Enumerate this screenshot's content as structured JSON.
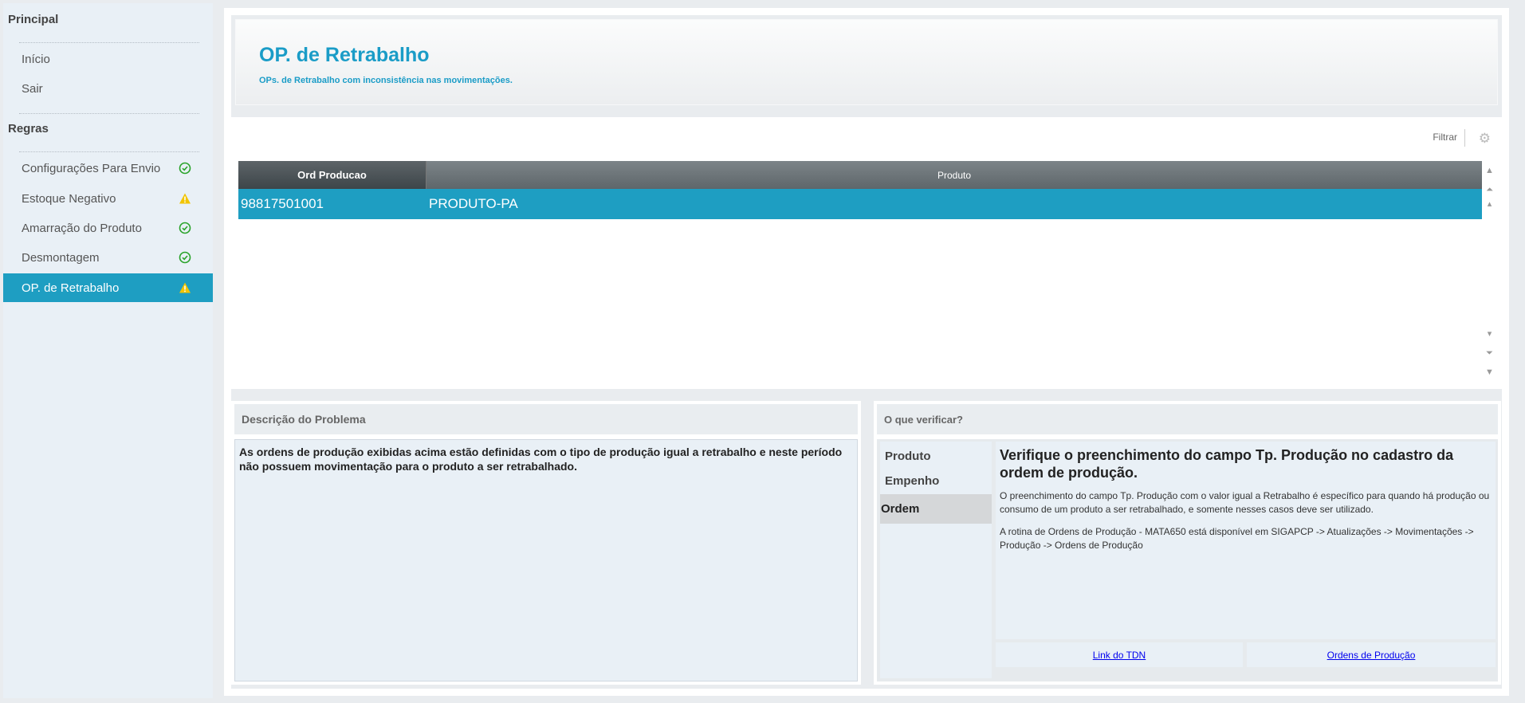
{
  "sidebar": {
    "section_principal": "Principal",
    "section_regras": "Regras",
    "nav": [
      {
        "label": "Início"
      },
      {
        "label": "Sair"
      }
    ],
    "rules": [
      {
        "label": "Configurações Para Envio",
        "status": "ok"
      },
      {
        "label": "Estoque Negativo",
        "status": "warning"
      },
      {
        "label": "Amarração do Produto",
        "status": "ok"
      },
      {
        "label": "Desmontagem",
        "status": "ok"
      },
      {
        "label": "OP. de Retrabalho",
        "status": "warning",
        "active": true
      }
    ]
  },
  "header": {
    "title": "OP. de Retrabalho",
    "subtitle": "OPs. de Retrabalho com inconsistência nas movimentações."
  },
  "grid": {
    "filter_label": "Filtrar",
    "columns": [
      "Ord Producao",
      "Produto"
    ],
    "rows": [
      {
        "ord_producao": "98817501001",
        "produto": "PRODUTO-PA"
      }
    ]
  },
  "description": {
    "title": "Descrição do Problema",
    "text": "As ordens de produção exibidas acima estão definidas com o tipo de produção igual a retrabalho e neste período não possuem movimentação para o produto a ser retrabalhado."
  },
  "check": {
    "title": "O que verificar?",
    "tabs": [
      {
        "label": "Produto"
      },
      {
        "label": "Empenho"
      },
      {
        "label": "Ordem",
        "active": true
      }
    ],
    "heading": "Verifique o preenchimento do campo Tp. Produção no cadastro da ordem de produção.",
    "paragraph1": "O preenchimento do campo Tp. Produção com o valor igual a Retrabalho é específico para quando há produção ou consumo de um produto a ser retrabalhado, e somente nesses casos deve ser utilizado.",
    "paragraph2": "A rotina de Ordens de Produção - MATA650 está disponível em SIGAPCP -> Atualizações -> Movimentações -> Produção -> Ordens de Produção",
    "links": [
      {
        "label": "Link do TDN"
      },
      {
        "label": "Ordens de Produção"
      }
    ]
  },
  "colors": {
    "accent": "#1e9ec2",
    "ok": "#2aa32a",
    "warning": "#f2c400"
  }
}
